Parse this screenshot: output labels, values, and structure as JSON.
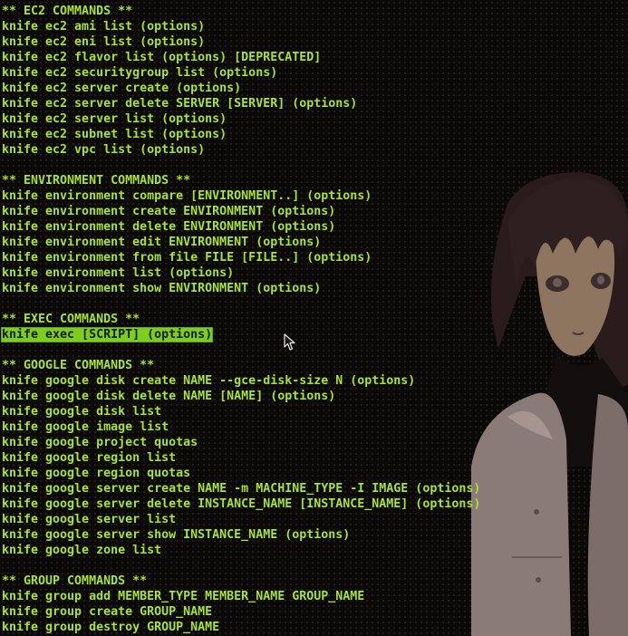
{
  "colors": {
    "text": "#a8e23a",
    "background": "#0c0909",
    "selection_bg": "#7ccd1e",
    "selection_fg": "#1a1a1a"
  },
  "icons": {
    "cursor": "mouse-pointer-arrow-icon"
  },
  "lines": [
    "** EC2 COMMANDS **",
    "knife ec2 ami list (options)",
    "knife ec2 eni list (options)",
    "knife ec2 flavor list (options) [DEPRECATED]",
    "knife ec2 securitygroup list (options)",
    "knife ec2 server create (options)",
    "knife ec2 server delete SERVER [SERVER] (options)",
    "knife ec2 server list (options)",
    "knife ec2 subnet list (options)",
    "knife ec2 vpc list (options)",
    "",
    "** ENVIRONMENT COMMANDS **",
    "knife environment compare [ENVIRONMENT..] (options)",
    "knife environment create ENVIRONMENT (options)",
    "knife environment delete ENVIRONMENT (options)",
    "knife environment edit ENVIRONMENT (options)",
    "knife environment from file FILE [FILE..] (options)",
    "knife environment list (options)",
    "knife environment show ENVIRONMENT (options)",
    "",
    "** EXEC COMMANDS **",
    "knife exec [SCRIPT] (options)",
    "",
    "** GOOGLE COMMANDS **",
    "knife google disk create NAME --gce-disk-size N (options)",
    "knife google disk delete NAME [NAME] (options)",
    "knife google disk list",
    "knife google image list",
    "knife google project quotas",
    "knife google region list",
    "knife google region quotas",
    "knife google server create NAME -m MACHINE_TYPE -I IMAGE (options)",
    "knife google server delete INSTANCE_NAME [INSTANCE_NAME] (options)",
    "knife google server list",
    "knife google server show INSTANCE_NAME (options)",
    "knife google zone list",
    "",
    "** GROUP COMMANDS **",
    "knife group add MEMBER_TYPE MEMBER_NAME GROUP_NAME",
    "knife group create GROUP_NAME",
    "knife group destroy GROUP_NAME"
  ],
  "selected_line_index": 21
}
